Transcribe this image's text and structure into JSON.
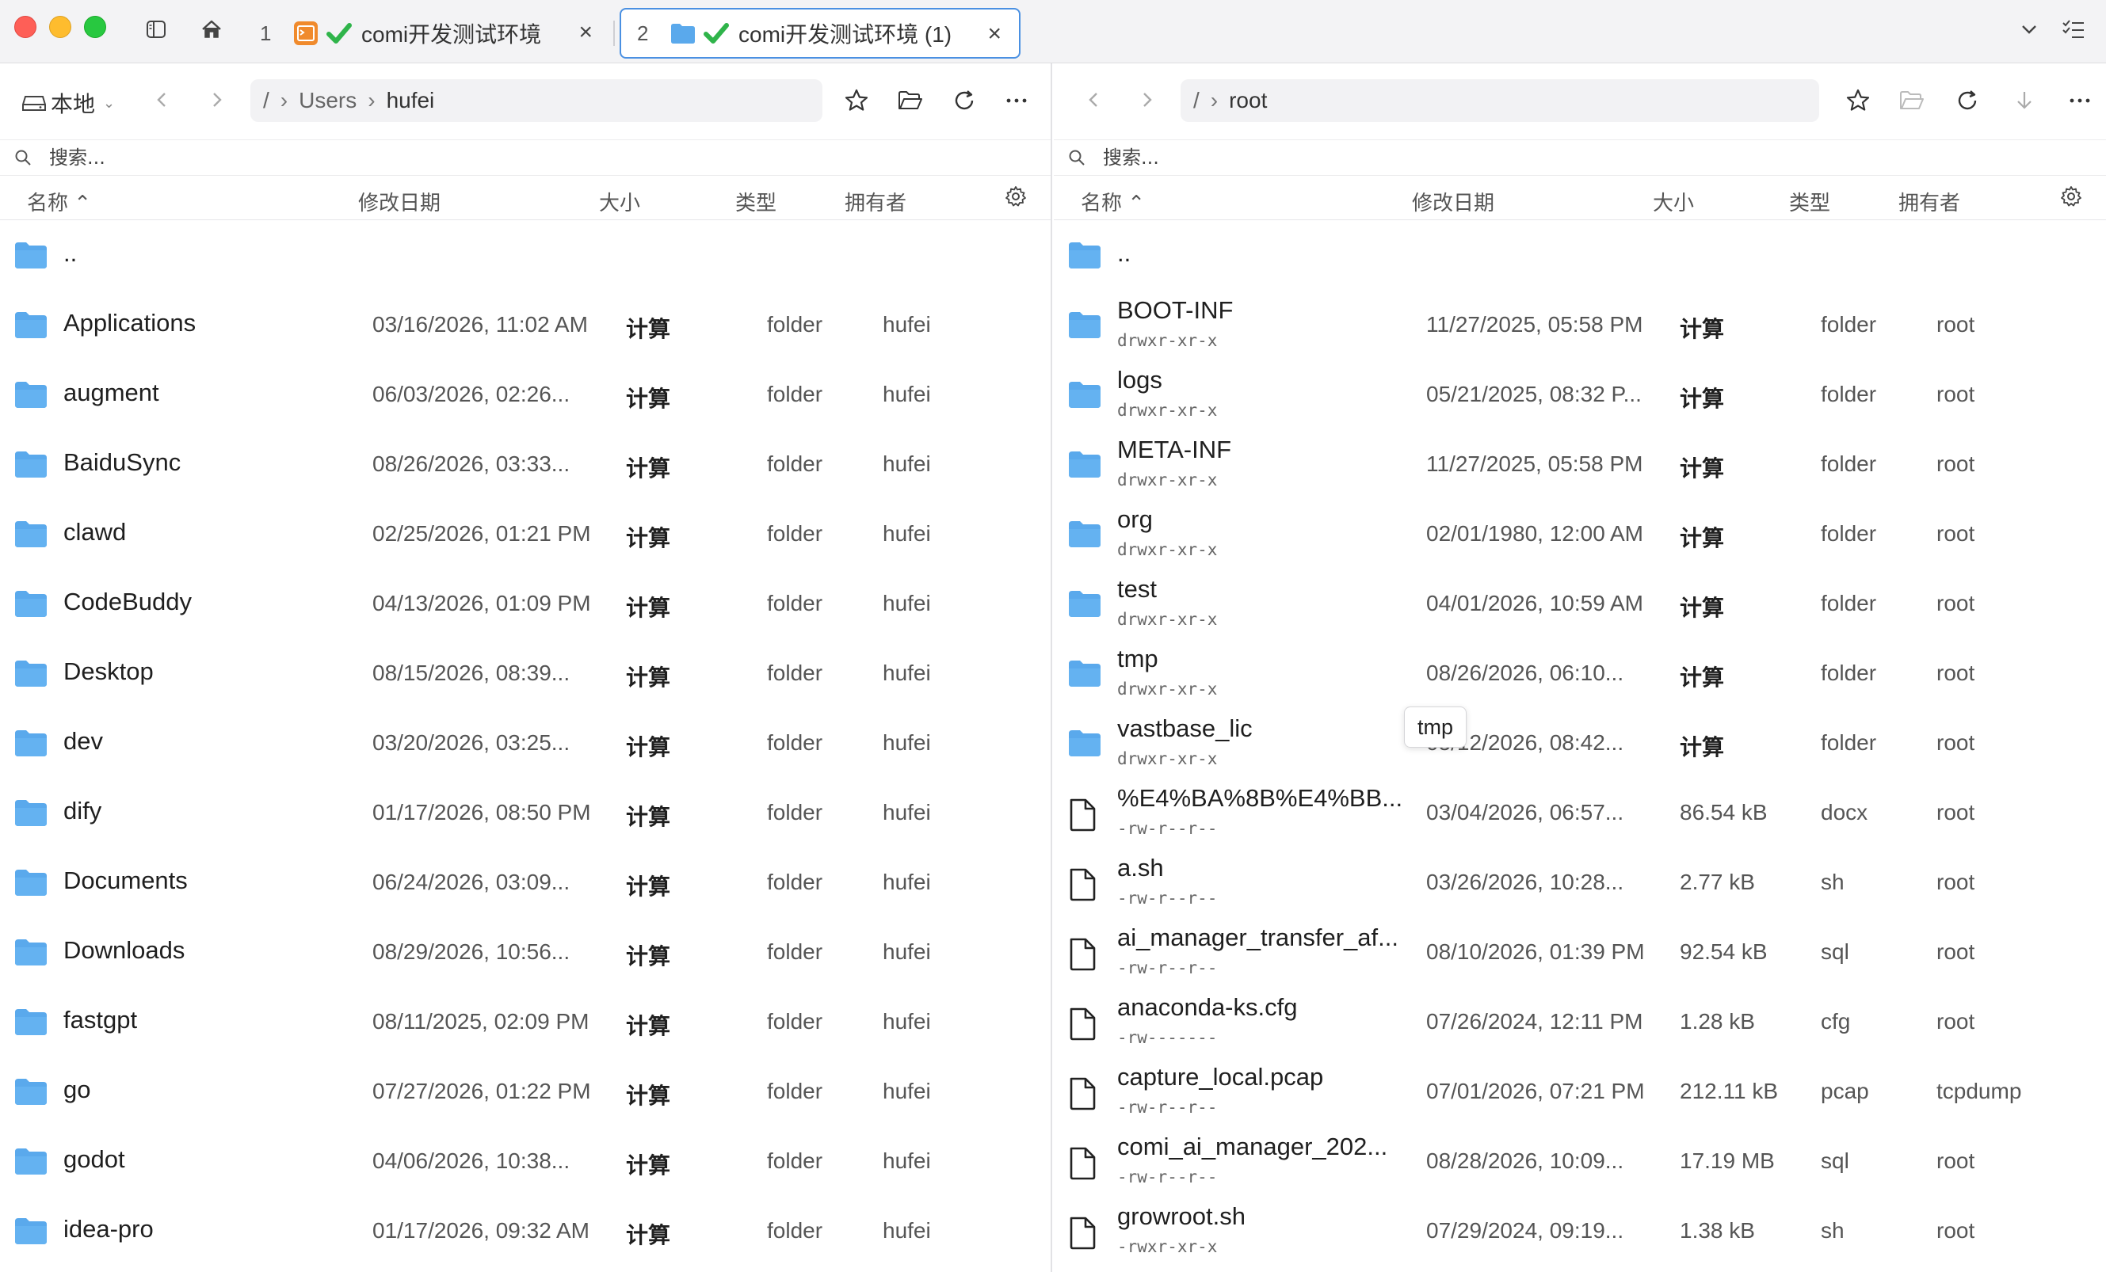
{
  "tabs": [
    {
      "num": "1",
      "label": "comi开发测试环境",
      "type": "terminal"
    },
    {
      "num": "2",
      "label": "comi开发测试环境 (1)",
      "type": "folder"
    }
  ],
  "colors": {
    "accent": "#4a90e2",
    "folder": "#5aa9ec",
    "check": "#2fb44a",
    "terminal": "#f08a2c"
  },
  "left": {
    "location_label": "本地",
    "path": [
      "/",
      "Users",
      "hufei"
    ],
    "search_placeholder": "搜索...",
    "columns": {
      "name": "名称 ⌃",
      "date": "修改日期",
      "size": "大小",
      "type": "类型",
      "owner": "拥有者"
    },
    "rows": [
      {
        "name": "..",
        "date": "",
        "size": "",
        "type": "",
        "owner": ""
      },
      {
        "name": "Applications",
        "date": "03/16/2026, 11:02 AM",
        "size": "计算",
        "type": "folder",
        "owner": "hufei"
      },
      {
        "name": "augment",
        "date": "06/03/2026, 02:26...",
        "size": "计算",
        "type": "folder",
        "owner": "hufei"
      },
      {
        "name": "BaiduSync",
        "date": "08/26/2026, 03:33...",
        "size": "计算",
        "type": "folder",
        "owner": "hufei"
      },
      {
        "name": "clawd",
        "date": "02/25/2026, 01:21 PM",
        "size": "计算",
        "type": "folder",
        "owner": "hufei"
      },
      {
        "name": "CodeBuddy",
        "date": "04/13/2026, 01:09 PM",
        "size": "计算",
        "type": "folder",
        "owner": "hufei"
      },
      {
        "name": "Desktop",
        "date": "08/15/2026, 08:39...",
        "size": "计算",
        "type": "folder",
        "owner": "hufei"
      },
      {
        "name": "dev",
        "date": "03/20/2026, 03:25...",
        "size": "计算",
        "type": "folder",
        "owner": "hufei"
      },
      {
        "name": "dify",
        "date": "01/17/2026, 08:50 PM",
        "size": "计算",
        "type": "folder",
        "owner": "hufei"
      },
      {
        "name": "Documents",
        "date": "06/24/2026, 03:09...",
        "size": "计算",
        "type": "folder",
        "owner": "hufei"
      },
      {
        "name": "Downloads",
        "date": "08/29/2026, 10:56...",
        "size": "计算",
        "type": "folder",
        "owner": "hufei"
      },
      {
        "name": "fastgpt",
        "date": "08/11/2025, 02:09 PM",
        "size": "计算",
        "type": "folder",
        "owner": "hufei"
      },
      {
        "name": "go",
        "date": "07/27/2026, 01:22 PM",
        "size": "计算",
        "type": "folder",
        "owner": "hufei"
      },
      {
        "name": "godot",
        "date": "04/06/2026, 10:38...",
        "size": "计算",
        "type": "folder",
        "owner": "hufei"
      },
      {
        "name": "idea-pro",
        "date": "01/17/2026, 09:32 AM",
        "size": "计算",
        "type": "folder",
        "owner": "hufei"
      }
    ]
  },
  "right": {
    "path": [
      "/",
      "root"
    ],
    "search_placeholder": "搜索...",
    "columns": {
      "name": "名称 ⌃",
      "date": "修改日期",
      "size": "大小",
      "type": "类型",
      "owner": "拥有者"
    },
    "tooltip": "tmp",
    "rows": [
      {
        "name": "..",
        "perm": "",
        "date": "",
        "size": "",
        "type": "",
        "owner": "",
        "kind": "folder"
      },
      {
        "name": "BOOT-INF",
        "perm": "drwxr-xr-x",
        "date": "11/27/2025, 05:58 PM",
        "size": "计算",
        "type": "folder",
        "owner": "root",
        "kind": "folder"
      },
      {
        "name": "logs",
        "perm": "drwxr-xr-x",
        "date": "05/21/2025, 08:32 P...",
        "size": "计算",
        "type": "folder",
        "owner": "root",
        "kind": "folder"
      },
      {
        "name": "META-INF",
        "perm": "drwxr-xr-x",
        "date": "11/27/2025, 05:58 PM",
        "size": "计算",
        "type": "folder",
        "owner": "root",
        "kind": "folder"
      },
      {
        "name": "org",
        "perm": "drwxr-xr-x",
        "date": "02/01/1980, 12:00 AM",
        "size": "计算",
        "type": "folder",
        "owner": "root",
        "kind": "folder"
      },
      {
        "name": "test",
        "perm": "drwxr-xr-x",
        "date": "04/01/2026, 10:59 AM",
        "size": "计算",
        "type": "folder",
        "owner": "root",
        "kind": "folder"
      },
      {
        "name": "tmp",
        "perm": "drwxr-xr-x",
        "date": "08/26/2026, 06:10...",
        "size": "计算",
        "type": "folder",
        "owner": "root",
        "kind": "folder"
      },
      {
        "name": "vastbase_lic",
        "perm": "drwxr-xr-x",
        "date": "05/12/2026, 08:42...",
        "size": "计算",
        "type": "folder",
        "owner": "root",
        "kind": "folder"
      },
      {
        "name": "%E4%BA%8B%E4%BB...",
        "perm": "-rw-r--r--",
        "date": "03/04/2026, 06:57...",
        "size": "86.54 kB",
        "type": "docx",
        "owner": "root",
        "kind": "file"
      },
      {
        "name": "a.sh",
        "perm": "-rw-r--r--",
        "date": "03/26/2026, 10:28...",
        "size": "2.77 kB",
        "type": "sh",
        "owner": "root",
        "kind": "file"
      },
      {
        "name": "ai_manager_transfer_af...",
        "perm": "-rw-r--r--",
        "date": "08/10/2026, 01:39 PM",
        "size": "92.54 kB",
        "type": "sql",
        "owner": "root",
        "kind": "file"
      },
      {
        "name": "anaconda-ks.cfg",
        "perm": "-rw-------",
        "date": "07/26/2024, 12:11 PM",
        "size": "1.28 kB",
        "type": "cfg",
        "owner": "root",
        "kind": "file"
      },
      {
        "name": "capture_local.pcap",
        "perm": "-rw-r--r--",
        "date": "07/01/2026, 07:21 PM",
        "size": "212.11 kB",
        "type": "pcap",
        "owner": "tcpdump",
        "kind": "file"
      },
      {
        "name": "comi_ai_manager_202...",
        "perm": "-rw-r--r--",
        "date": "08/28/2026, 10:09...",
        "size": "17.19 MB",
        "type": "sql",
        "owner": "root",
        "kind": "file"
      },
      {
        "name": "growroot.sh",
        "perm": "-rwxr-xr-x",
        "date": "07/29/2024, 09:19...",
        "size": "1.38 kB",
        "type": "sh",
        "owner": "root",
        "kind": "file"
      }
    ]
  }
}
